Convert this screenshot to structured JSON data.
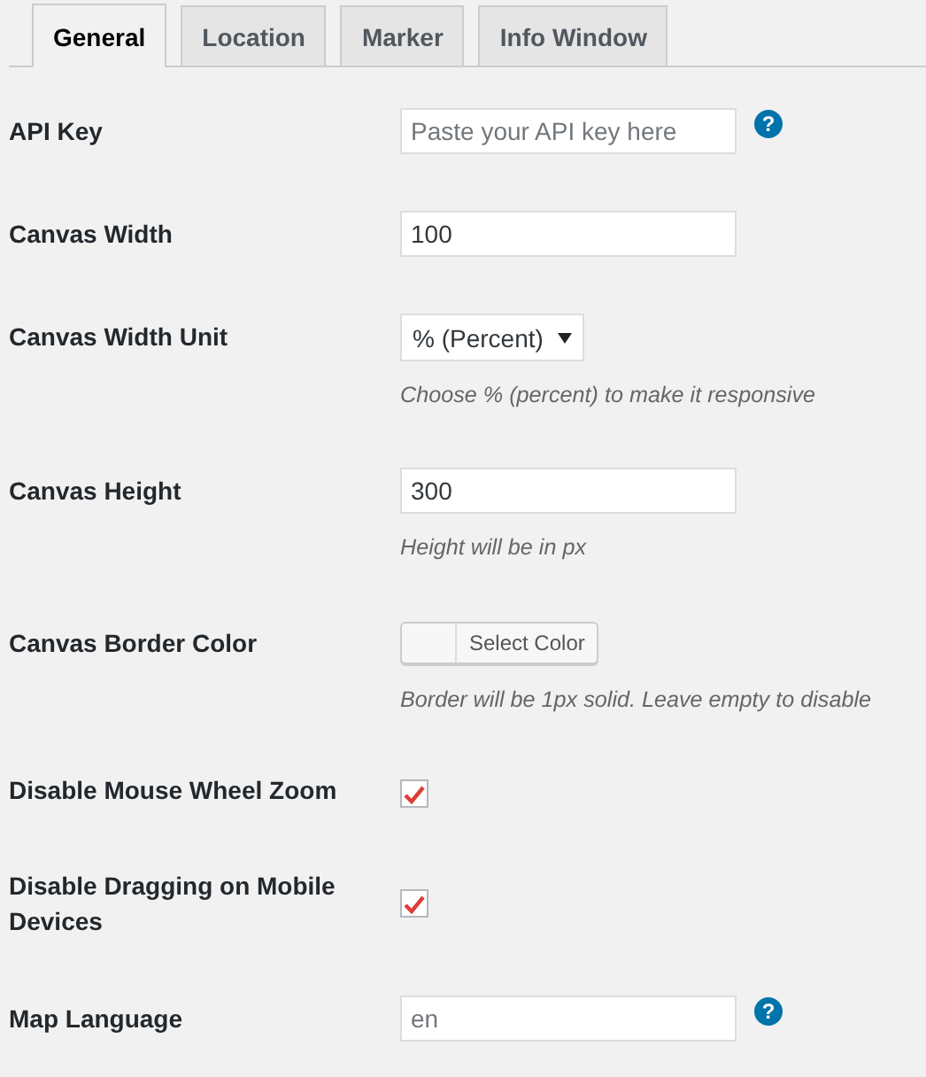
{
  "tabs": [
    {
      "label": "General",
      "selected": true
    },
    {
      "label": "Location",
      "selected": false
    },
    {
      "label": "Marker",
      "selected": false
    },
    {
      "label": "Info Window",
      "selected": false
    }
  ],
  "settings": [
    {
      "kind": "text",
      "label": "API Key",
      "placeholder": "Paste your API key here",
      "help": "?"
    },
    {
      "kind": "text",
      "label": "Canvas Width",
      "value": "100"
    },
    {
      "kind": "select",
      "label": "Canvas Width Unit",
      "value": "% (Percent)",
      "hint": "Choose % (percent) to make it responsive"
    },
    {
      "kind": "text",
      "label": "Canvas Height",
      "value": "300",
      "hint": "Height will be in px"
    },
    {
      "kind": "color",
      "label": "Canvas Border Color",
      "button": "Select Color",
      "hint": "Border will be 1px solid. Leave empty to disable"
    },
    {
      "kind": "checkbox",
      "label": "Disable Mouse Wheel Zoom",
      "checked": true
    },
    {
      "kind": "checkbox",
      "label": "Disable Dragging on Mobile Devices",
      "checked": true
    },
    {
      "kind": "text",
      "label": "Map Language",
      "placeholder": "en",
      "help": "?"
    }
  ]
}
